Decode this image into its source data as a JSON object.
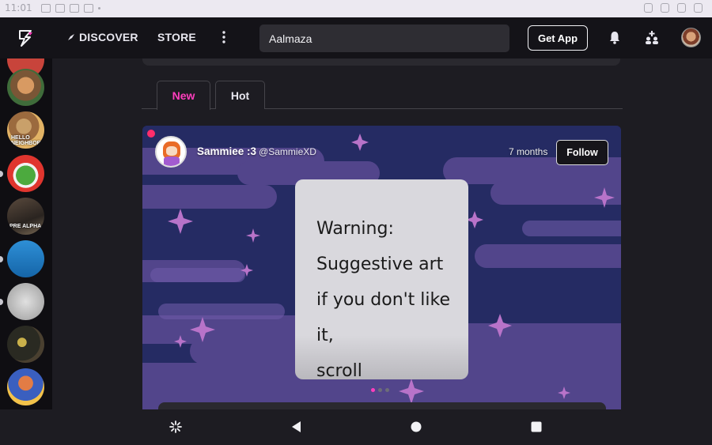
{
  "status_bar": {
    "time": "11:01"
  },
  "appbar": {
    "discover_label": "DISCOVER",
    "store_label": "STORE",
    "search_value": "Aalmaza",
    "get_app_label": "Get App",
    "icons": [
      "logo-bolt-icon",
      "compass-icon",
      "kebab-menu-icon",
      "bell-icon",
      "plus-people-icon",
      "avatar"
    ]
  },
  "sidebar": {
    "items": [
      {
        "label": ""
      },
      {
        "label": ""
      },
      {
        "label": "HELLO NEIGHBOR"
      },
      {
        "label": ""
      },
      {
        "label": "PRE ALPHA"
      },
      {
        "label": ""
      },
      {
        "label": ""
      },
      {
        "label": ""
      },
      {
        "label": ""
      }
    ]
  },
  "tabs": [
    {
      "label": "New",
      "active": true
    },
    {
      "label": "Hot",
      "active": false
    }
  ],
  "post": {
    "author_name": "Sammiee :3",
    "author_handle": "@SammieXD",
    "time": "7 months",
    "follow_label": "Follow",
    "warning_lines": [
      "Warning:",
      "Suggestive art",
      "if you don't like it,",
      "scroll"
    ],
    "pager": {
      "count": 3,
      "active": 0
    }
  },
  "colors": {
    "accent": "#ff3ebd",
    "post_bg": "#252b63",
    "online": "#ff2d6b"
  }
}
